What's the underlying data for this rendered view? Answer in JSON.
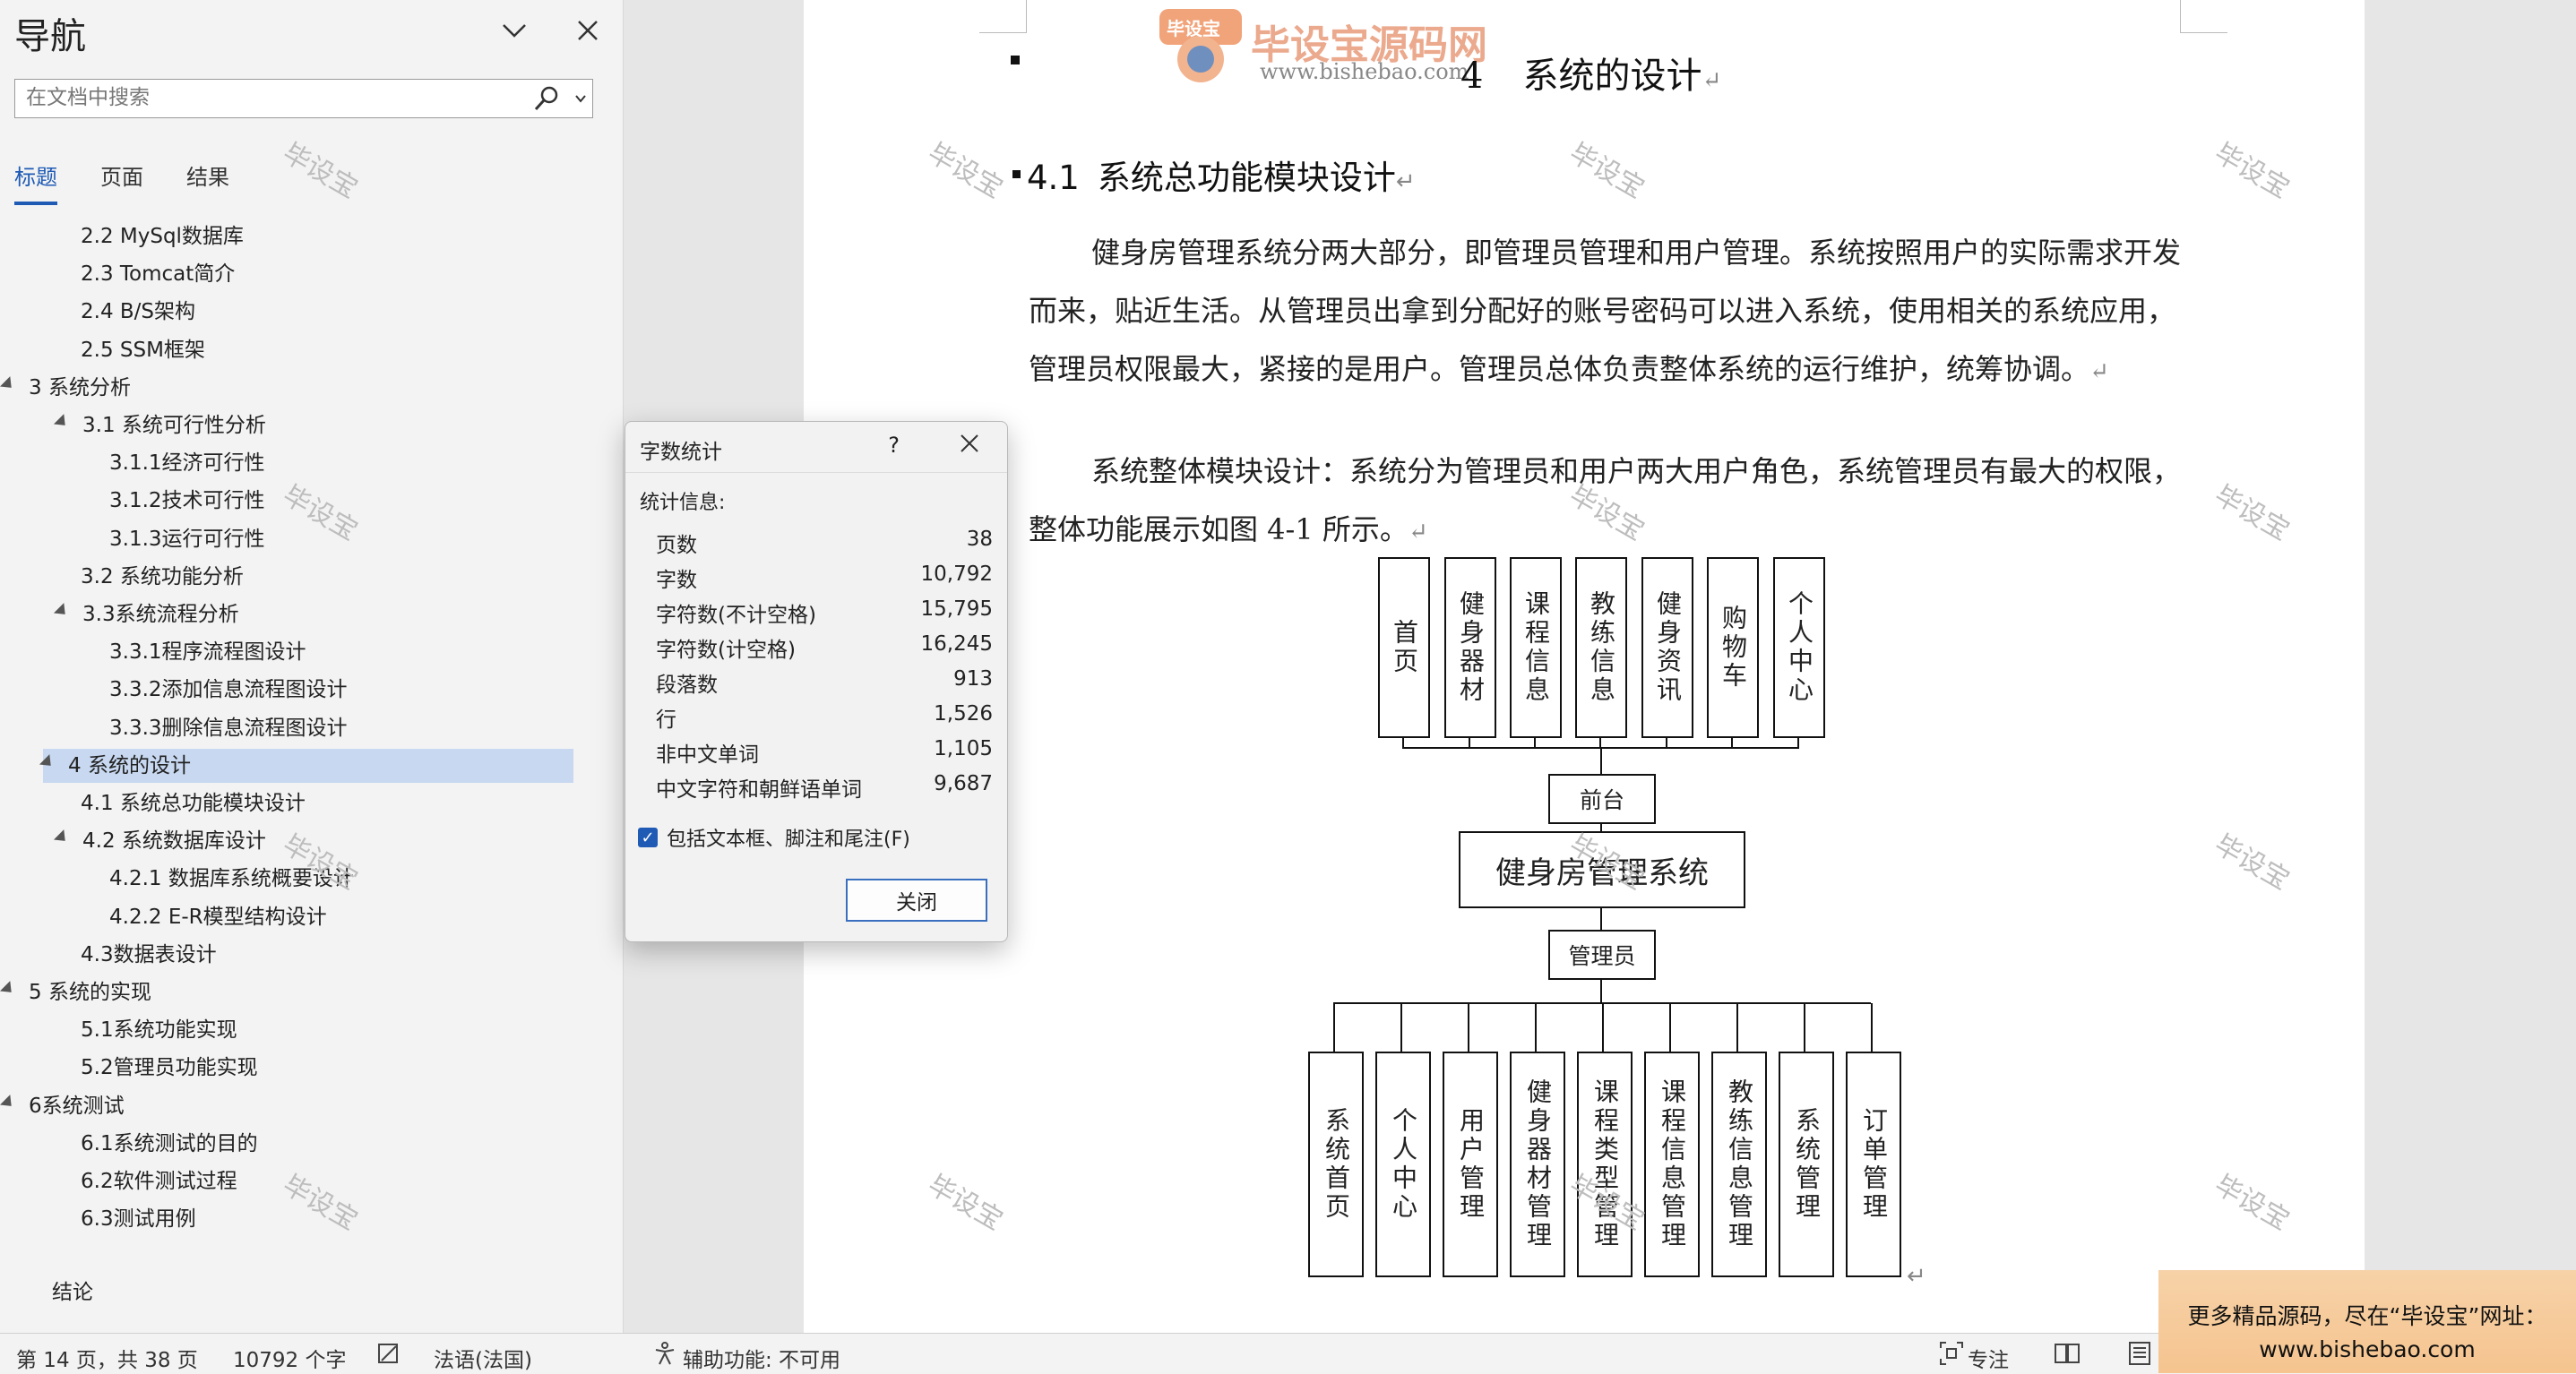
{
  "nav": {
    "title": "导航",
    "search_placeholder": "在文档中搜索",
    "tabs": [
      "标题",
      "页面",
      "结果"
    ],
    "tree": [
      {
        "label": "2.2 MySql数据库",
        "level": 2
      },
      {
        "label": "2.3 Tomcat简介",
        "level": 2
      },
      {
        "label": "2.4 B/S架构",
        "level": 2
      },
      {
        "label": "2.5 SSM框架",
        "level": 2
      },
      {
        "label": "3  系统分析",
        "level": 1,
        "expandable": true
      },
      {
        "label": "3.1 系统可行性分析",
        "level": 2,
        "expandable": true
      },
      {
        "label": "3.1.1经济可行性",
        "level": 3
      },
      {
        "label": "3.1.2技术可行性",
        "level": 3
      },
      {
        "label": "3.1.3运行可行性",
        "level": 3
      },
      {
        "label": "3.2 系统功能分析",
        "level": 2
      },
      {
        "label": "3.3系统流程分析",
        "level": 2,
        "expandable": true
      },
      {
        "label": "3.3.1程序流程图设计",
        "level": 3
      },
      {
        "label": "3.3.2添加信息流程图设计",
        "level": 3
      },
      {
        "label": "3.3.3删除信息流程图设计",
        "level": 3
      },
      {
        "label": "4  系统的设计",
        "level": 1,
        "expandable": true,
        "selected": true
      },
      {
        "label": "4.1 系统总功能模块设计",
        "level": 2
      },
      {
        "label": "4.2 系统数据库设计",
        "level": 2,
        "expandable": true
      },
      {
        "label": "4.2.1 数据库系统概要设计",
        "level": 3
      },
      {
        "label": "4.2.2 E-R模型结构设计",
        "level": 3
      },
      {
        "label": "4.3数据表设计",
        "level": 2
      },
      {
        "label": "5  系统的实现",
        "level": 1,
        "expandable": true
      },
      {
        "label": "5.1系统功能实现",
        "level": 2
      },
      {
        "label": "5.2管理员功能实现",
        "level": 2
      },
      {
        "label": "6系统测试",
        "level": 1,
        "expandable": true
      },
      {
        "label": "6.1系统测试的目的",
        "level": 2
      },
      {
        "label": "6.2软件测试过程",
        "level": 2
      },
      {
        "label": "6.3测试用例",
        "level": 2
      },
      {
        "label": "结论",
        "level": 1
      }
    ]
  },
  "watermark": "毕设宝",
  "logo": {
    "name": "毕设宝源码网",
    "url": "www.bishebao.com",
    "badge": "毕设宝"
  },
  "document": {
    "chapter_number": "4",
    "chapter_title": "系统的设计",
    "section_number": "4.1",
    "section_title": "系统总功能模块设计",
    "para1": "健身房管理系统分两大部分，即管理员管理和用户管理。系统按照用户的实际需求开发而来，贴近生活。从管理员出拿到分配好的账号密码可以进入系统，使用相关的系统应用，管理员权限最大，紧接的是用户。管理员总体负责整体系统的运行维护，统筹协调。",
    "para2": "系统整体模块设计：系统分为管理员和用户两大用户角色，系统管理员有最大的权限，整体功能展示如图 4-1 所示。",
    "return_mark": "↵"
  },
  "diagram": {
    "front_modules": [
      "首页",
      "健身器材",
      "课程信息",
      "教练信息",
      "健身资讯",
      "购物车",
      "个人中心"
    ],
    "front_label": "前台",
    "system_label": "健身房管理系统",
    "admin_label": "管理员",
    "admin_modules": [
      "系统首页",
      "个人中心",
      "用户管理",
      "健身器材管理",
      "课程类型管理",
      "课程信息管理",
      "教练信息管理",
      "系统管理",
      "订单管理"
    ]
  },
  "dialog": {
    "title": "字数统计",
    "help": "?",
    "section": "统计信息:",
    "stats": [
      {
        "label": "页数",
        "value": "38"
      },
      {
        "label": "字数",
        "value": "10,792"
      },
      {
        "label": "字符数(不计空格)",
        "value": "15,795"
      },
      {
        "label": "字符数(计空格)",
        "value": "16,245"
      },
      {
        "label": "段落数",
        "value": "913"
      },
      {
        "label": "行",
        "value": "1,526"
      },
      {
        "label": "非中文单词",
        "value": "1,105"
      },
      {
        "label": "中文字符和朝鲜语单词",
        "value": "9,687"
      }
    ],
    "checkbox_label": "包括文本框、脚注和尾注(F)",
    "checkbox_checked": true,
    "close_label": "关闭"
  },
  "status": {
    "page": "第 14 页，共 38 页",
    "words": "10792 个字",
    "language": "法语(法国)",
    "accessibility": "辅助功能: 不可用",
    "focus": "专注"
  },
  "promo": {
    "line1": "更多精品源码，尽在“毕设宝”网址：",
    "line2": "www.bishebao.com"
  },
  "colors": {
    "accent": "#1f5bb5",
    "selection": "#c7d8f0",
    "promo": "#f5c48f"
  }
}
